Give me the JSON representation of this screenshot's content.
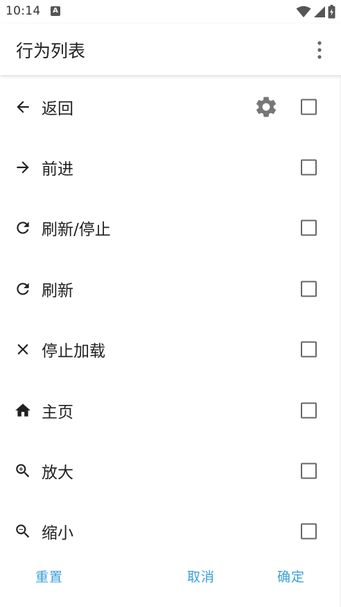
{
  "status_bar": {
    "time": "10:14",
    "notification_icon": "a-icon",
    "indicators": [
      "wifi-icon",
      "signal-icon",
      "battery-icon"
    ]
  },
  "toolbar": {
    "title": "行为列表",
    "menu_icon": "overflow-menu-icon"
  },
  "actions": [
    {
      "icon": "arrow-back-icon",
      "label": "返回",
      "has_settings": true,
      "checked": false
    },
    {
      "icon": "arrow-forward-icon",
      "label": "前进",
      "has_settings": false,
      "checked": false
    },
    {
      "icon": "refresh-icon",
      "label": "刷新/停止",
      "has_settings": false,
      "checked": false
    },
    {
      "icon": "refresh-icon",
      "label": "刷新",
      "has_settings": false,
      "checked": false
    },
    {
      "icon": "close-icon",
      "label": "停止加载",
      "has_settings": false,
      "checked": false
    },
    {
      "icon": "home-icon",
      "label": "主页",
      "has_settings": false,
      "checked": false
    },
    {
      "icon": "zoom-in-icon",
      "label": "放大",
      "has_settings": false,
      "checked": false
    },
    {
      "icon": "zoom-out-icon",
      "label": "缩小",
      "has_settings": false,
      "checked": false
    }
  ],
  "buttons": {
    "reset": "重置",
    "cancel": "取消",
    "ok": "确定"
  },
  "colors": {
    "accent": "#3a9fd6",
    "text": "#212121",
    "icon": "#212121",
    "gear": "#777777",
    "checkbox_border": "#666666"
  }
}
